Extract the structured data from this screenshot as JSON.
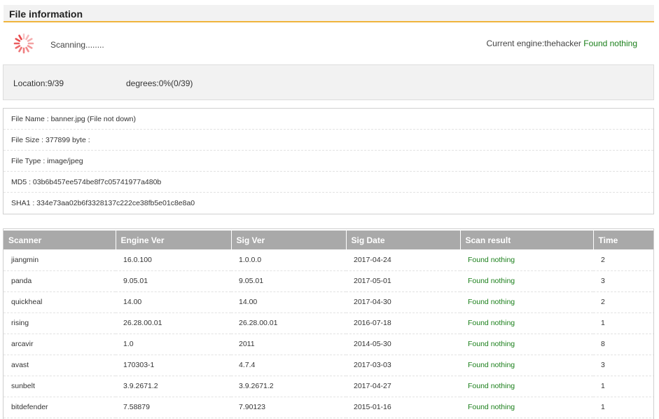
{
  "header": {
    "title": "File information"
  },
  "status": {
    "scanning_text": "Scanning........",
    "engine_label": "Current engine:thehacker",
    "engine_result": "Found nothing"
  },
  "progress": {
    "location": "Location:9/39",
    "degrees": "degrees:0%(0/39)"
  },
  "file_info": [
    "File Name : banner.jpg (File not down)",
    "File Size : 377899 byte :",
    "File Type : image/jpeg",
    "MD5 : 03b6b457ee574be8f7c05741977a480b",
    "SHA1 : 334e73aa02b6f3328137c222ce38fb5e01c8e8a0"
  ],
  "table": {
    "columns": [
      "Scanner",
      "Engine Ver",
      "Sig Ver",
      "Sig Date",
      "Scan result",
      "Time"
    ],
    "rows": [
      [
        "jiangmin",
        "16.0.100",
        "1.0.0.0",
        "2017-04-24",
        "Found nothing",
        "2"
      ],
      [
        "panda",
        "9.05.01",
        "9.05.01",
        "2017-05-01",
        "Found nothing",
        "3"
      ],
      [
        "quickheal",
        "14.00",
        "14.00",
        "2017-04-30",
        "Found nothing",
        "2"
      ],
      [
        "rising",
        "26.28.00.01",
        "26.28.00.01",
        "2016-07-18",
        "Found nothing",
        "1"
      ],
      [
        "arcavir",
        "1.0",
        "2011",
        "2014-05-30",
        "Found nothing",
        "8"
      ],
      [
        "avast",
        "170303-1",
        "4.7.4",
        "2017-03-03",
        "Found nothing",
        "3"
      ],
      [
        "sunbelt",
        "3.9.2671.2",
        "3.9.2671.2",
        "2017-04-27",
        "Found nothing",
        "1"
      ],
      [
        "bitdefender",
        "7.58879",
        "7.90123",
        "2015-01-16",
        "Found nothing",
        "1"
      ]
    ]
  },
  "colors": {
    "accent": "#f0b43c",
    "success": "#1a7f1a",
    "header_gray": "#a9a9a9",
    "spinner": "#e8474a"
  },
  "icons": {
    "spinner": "loading-spinner-icon"
  }
}
